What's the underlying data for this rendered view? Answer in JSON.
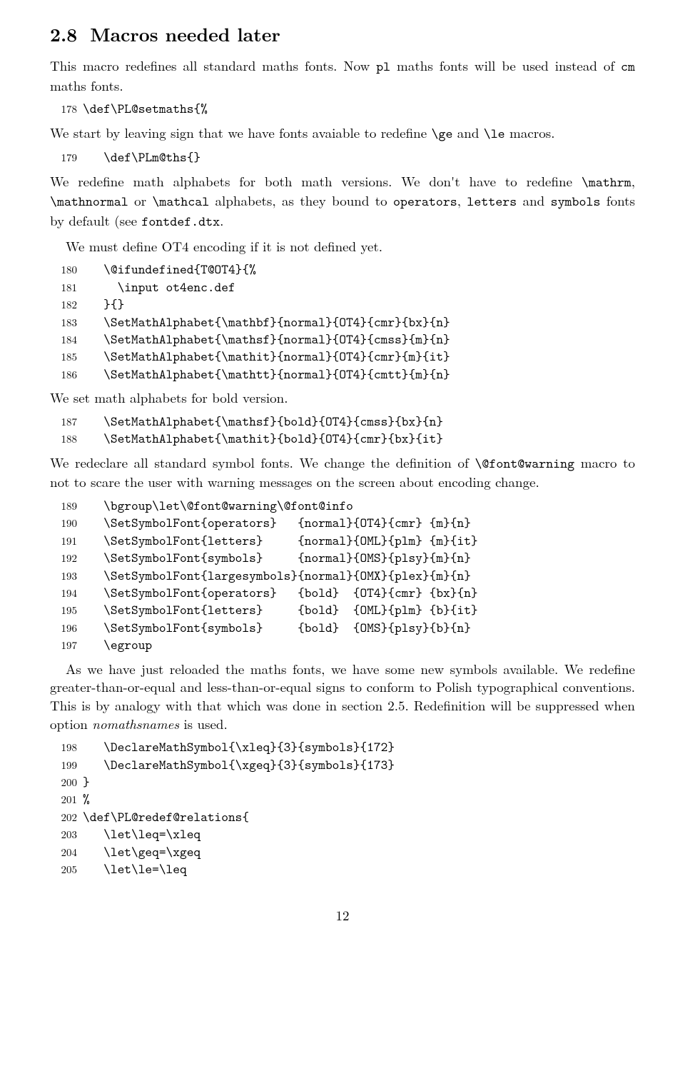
{
  "section": {
    "number": "2.8",
    "title": "Macros needed later"
  },
  "p1a": "This macro redefines all standard maths fonts. Now ",
  "p1b": "pl",
  "p1c": " maths fonts will be used instead of ",
  "p1d": "cm",
  "p1e": " maths fonts.",
  "code1": [
    {
      "n": "178",
      "t": "\\def\\PL@setmaths{%"
    }
  ],
  "p2a": "We start by leaving sign that we have fonts avaiable to redefine ",
  "p2b": "\\ge",
  "p2c": " and ",
  "p2d": "\\le",
  "p2e": " macros.",
  "code2": [
    {
      "n": "179",
      "t": "   \\def\\PLm@ths{}"
    }
  ],
  "p3a": "We redefine math alphabets for both math versions. We don't have to redefine ",
  "p3b": "\\mathrm",
  "p3c": ", ",
  "p3d": "\\mathnormal",
  "p3e": " or ",
  "p3f": "\\mathcal",
  "p3g": " alphabets, as they bound to ",
  "p3h": "operators",
  "p3i": ", ",
  "p3j": "letters",
  "p3k": " and ",
  "p3l": "symbols",
  "p3m": " fonts by default (see ",
  "p3n": "fontdef.dtx",
  "p3o": ".",
  "p4": "We must define OT4 encoding if it is not defined yet.",
  "code3": [
    {
      "n": "180",
      "t": "   \\@ifundefined{T@OT4}{%"
    },
    {
      "n": "181",
      "t": "     \\input ot4enc.def"
    },
    {
      "n": "182",
      "t": "   }{}"
    },
    {
      "n": "183",
      "t": "   \\SetMathAlphabet{\\mathbf}{normal}{OT4}{cmr}{bx}{n}"
    },
    {
      "n": "184",
      "t": "   \\SetMathAlphabet{\\mathsf}{normal}{OT4}{cmss}{m}{n}"
    },
    {
      "n": "185",
      "t": "   \\SetMathAlphabet{\\mathit}{normal}{OT4}{cmr}{m}{it}"
    },
    {
      "n": "186",
      "t": "   \\SetMathAlphabet{\\mathtt}{normal}{OT4}{cmtt}{m}{n}"
    }
  ],
  "p5": "We set math alphabets for bold version.",
  "code4": [
    {
      "n": "187",
      "t": "   \\SetMathAlphabet{\\mathsf}{bold}{OT4}{cmss}{bx}{n}"
    },
    {
      "n": "188",
      "t": "   \\SetMathAlphabet{\\mathit}{bold}{OT4}{cmr}{bx}{it}"
    }
  ],
  "p6a": "We redeclare all standard symbol fonts. We change the definition of ",
  "p6b": "\\@font@warning",
  "p6c": " macro to not to scare the user with warning messages on the screen about encoding change.",
  "code5": [
    {
      "n": "189",
      "t": "   \\bgroup\\let\\@font@warning\\@font@info"
    },
    {
      "n": "190",
      "t": "   \\SetSymbolFont{operators}   {normal}{OT4}{cmr} {m}{n}"
    },
    {
      "n": "191",
      "t": "   \\SetSymbolFont{letters}     {normal}{OML}{plm} {m}{it}"
    },
    {
      "n": "192",
      "t": "   \\SetSymbolFont{symbols}     {normal}{OMS}{plsy}{m}{n}"
    },
    {
      "n": "193",
      "t": "   \\SetSymbolFont{largesymbols}{normal}{OMX}{plex}{m}{n}"
    },
    {
      "n": "194",
      "t": "   \\SetSymbolFont{operators}   {bold}  {OT4}{cmr} {bx}{n}"
    },
    {
      "n": "195",
      "t": "   \\SetSymbolFont{letters}     {bold}  {OML}{plm} {b}{it}"
    },
    {
      "n": "196",
      "t": "   \\SetSymbolFont{symbols}     {bold}  {OMS}{plsy}{b}{n}"
    },
    {
      "n": "197",
      "t": "   \\egroup"
    }
  ],
  "p7a": "As we have just reloaded the maths fonts, we have some new symbols available. We redefine greater-than-or-equal and less-than-or-equal signs to conform to Polish typographical conventions. This is by analogy with that which was done in section 2.5. Redefinition will be suppressed when option ",
  "p7b": "nomathsnames",
  "p7c": " is used.",
  "code6": [
    {
      "n": "198",
      "t": "   \\DeclareMathSymbol{\\xleq}{3}{symbols}{172}"
    },
    {
      "n": "199",
      "t": "   \\DeclareMathSymbol{\\xgeq}{3}{symbols}{173}"
    },
    {
      "n": "200",
      "t": "}"
    },
    {
      "n": "201",
      "t": "%"
    },
    {
      "n": "202",
      "t": "\\def\\PL@redef@relations{"
    },
    {
      "n": "203",
      "t": "   \\let\\leq=\\xleq"
    },
    {
      "n": "204",
      "t": "   \\let\\geq=\\xgeq"
    },
    {
      "n": "205",
      "t": "   \\let\\le=\\leq"
    }
  ],
  "pagenum": "12"
}
